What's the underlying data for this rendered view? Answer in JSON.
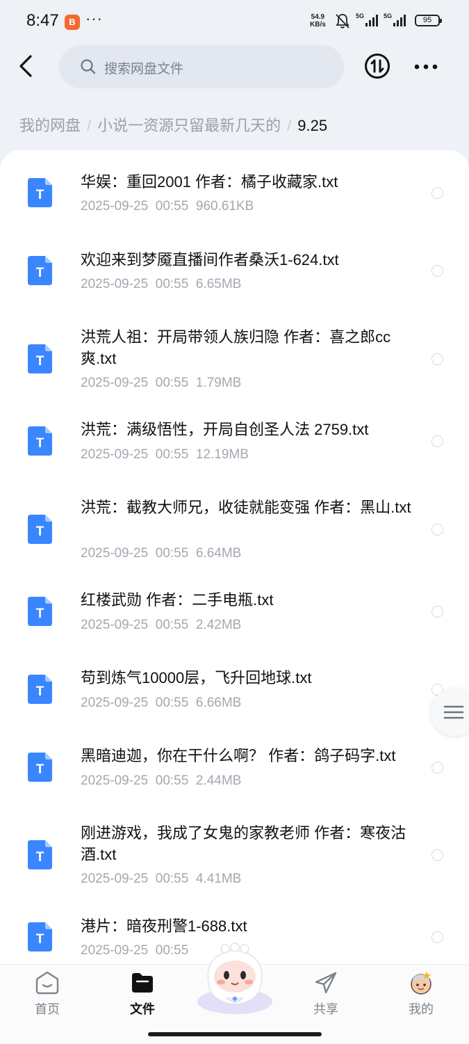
{
  "status_bar": {
    "time": "8:47",
    "app_icon_glyph": "B",
    "dots": "···",
    "net_speed_value": "54.9",
    "net_speed_unit": "KB/s",
    "signal_1": "5G",
    "signal_2": "5G",
    "battery": "95"
  },
  "header": {
    "search_placeholder": "搜索网盘文件"
  },
  "breadcrumb": {
    "items": [
      "我的网盘",
      "小说一资源只留最新几天的"
    ],
    "current": "9.25",
    "separator": "/"
  },
  "files": [
    {
      "name": "华娱：重回2001 作者：橘子收藏家.txt",
      "date": "2025-09-25",
      "time": "00:55",
      "size": "960.61KB"
    },
    {
      "name": "欢迎来到梦魇直播间作者桑沃1-624.txt",
      "date": "2025-09-25",
      "time": "00:55",
      "size": "6.65MB"
    },
    {
      "name": "洪荒人祖：开局带领人族归隐 作者：喜之郎cc爽.txt",
      "date": "2025-09-25",
      "time": "00:55",
      "size": "1.79MB"
    },
    {
      "name": "洪荒：满级悟性，开局自创圣人法 2759.txt",
      "date": "2025-09-25",
      "time": "00:55",
      "size": "12.19MB"
    },
    {
      "name": "洪荒：截教大师兄，收徒就能变强 作者：黑山.txt",
      "date": "2025-09-25",
      "time": "00:55",
      "size": "6.64MB"
    },
    {
      "name": "红楼武勋 作者：二手电瓶.txt",
      "date": "2025-09-25",
      "time": "00:55",
      "size": "2.42MB"
    },
    {
      "name": "苟到炼气10000层，飞升回地球.txt",
      "date": "2025-09-25",
      "time": "00:55",
      "size": "6.66MB"
    },
    {
      "name": "黑暗迪迦，你在干什么啊？ 作者：鸽子码字.txt",
      "date": "2025-09-25",
      "time": "00:55",
      "size": "2.44MB"
    },
    {
      "name": "刚进游戏，我成了女鬼的家教老师 作者：寒夜沽酒.txt",
      "date": "2025-09-25",
      "time": "00:55",
      "size": "4.41MB"
    },
    {
      "name": "港片：暗夜刑警1-688.txt",
      "date": "2025-09-25",
      "time": "00:55",
      "size": ""
    }
  ],
  "file_icon_letter": "T",
  "nav": {
    "home": "首页",
    "files": "文件",
    "share": "共享",
    "mine": "我的"
  },
  "colors": {
    "accent_blue": "#3a86ff",
    "background": "#eef1f6",
    "card": "#ffffff"
  }
}
